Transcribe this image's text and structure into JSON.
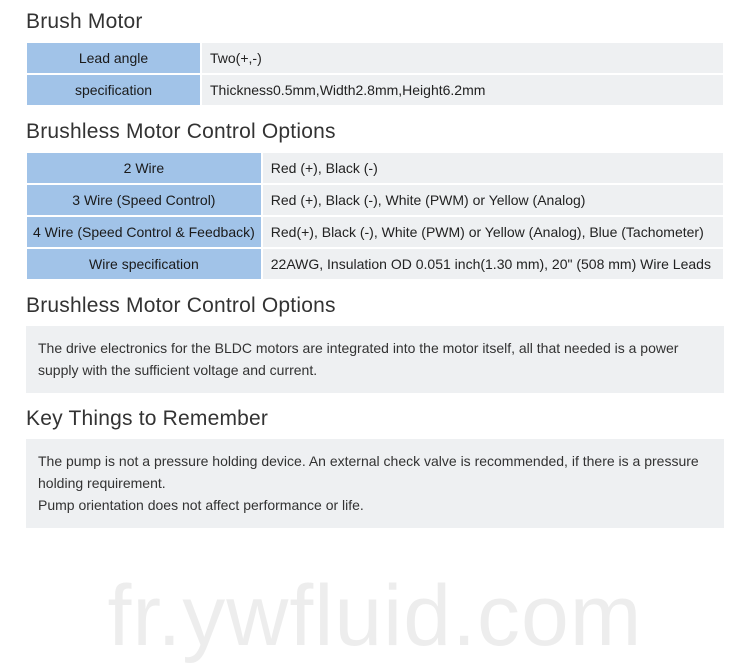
{
  "section1": {
    "heading": "Brush Motor",
    "rows": [
      {
        "label": "Lead angle",
        "value": "Two(+,-)"
      },
      {
        "label": "specification",
        "value": "Thickness0.5mm,Width2.8mm,Height6.2mm"
      }
    ]
  },
  "section2": {
    "heading": "Brushless Motor Control Options",
    "rows": [
      {
        "label": "2 Wire",
        "value": "Red (+), Black (-)"
      },
      {
        "label": "3 Wire (Speed Control)",
        "value": "Red (+), Black (-), White (PWM) or Yellow (Analog)"
      },
      {
        "label": "4 Wire (Speed Control & Feedback)",
        "value": "Red(+), Black (-), White (PWM) or Yellow (Analog), Blue (Tachometer)"
      },
      {
        "label": "Wire specification",
        "value": "22AWG, Insulation OD 0.051 inch(1.30 mm), 20\" (508 mm) Wire Leads"
      }
    ]
  },
  "section3": {
    "heading": "Brushless Motor Control Options",
    "body": "The drive electronics for the BLDC motors are integrated into the motor itself, all that needed is a power supply with the sufficient voltage and current."
  },
  "section4": {
    "heading": "Key Things to Remember",
    "body_line1": "The pump is not a pressure holding device. An external check valve is recommended, if there is a pressure holding requirement.",
    "body_line2": "Pump orientation does not affect performance or life."
  },
  "watermark": "fr.ywfluid.com"
}
